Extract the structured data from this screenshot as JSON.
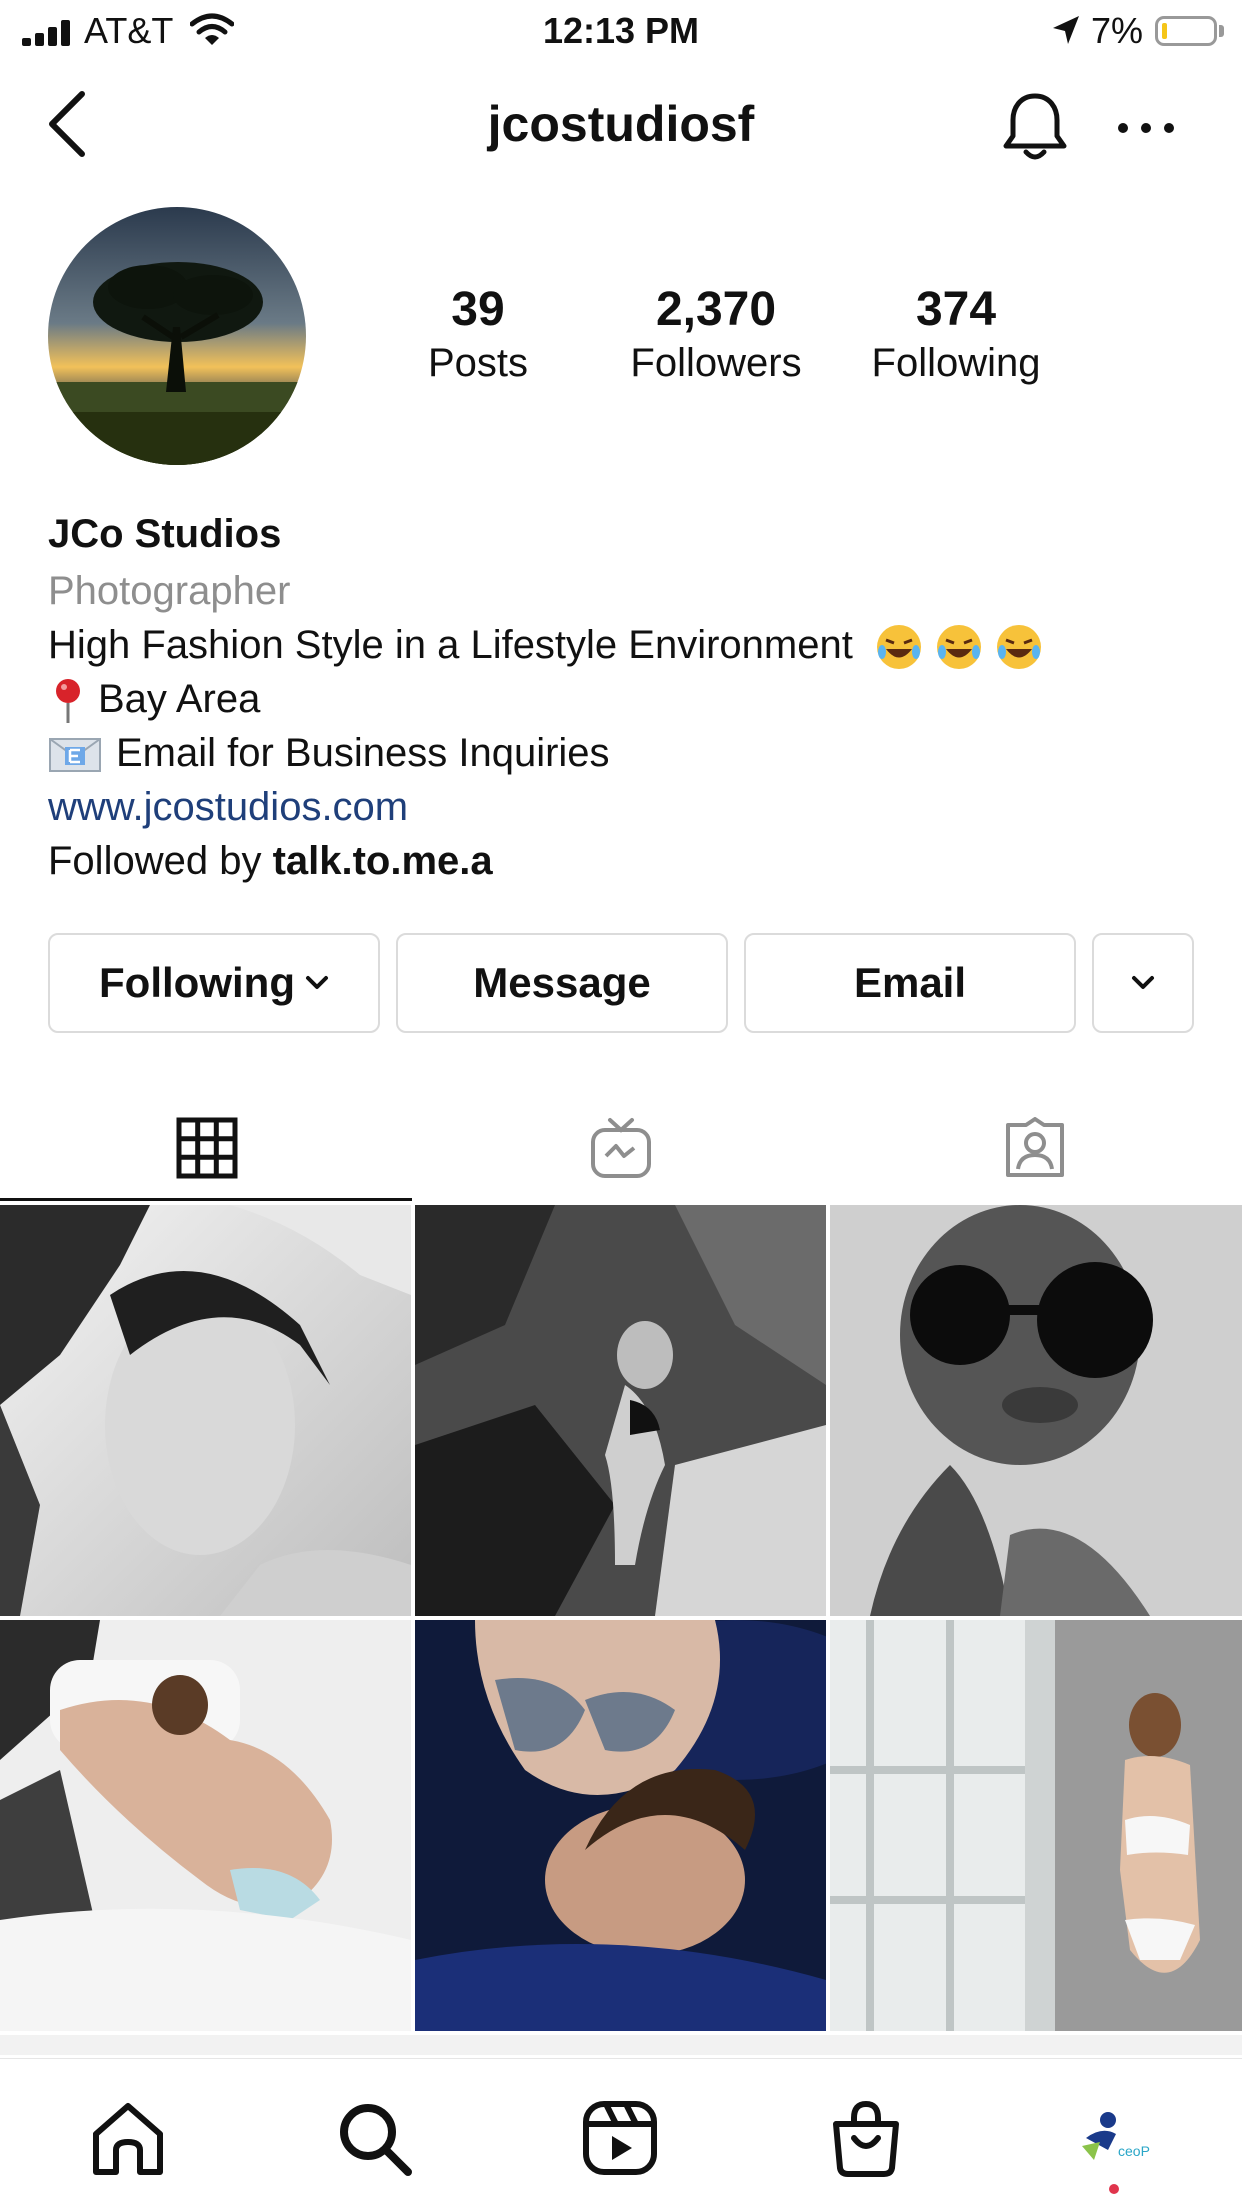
{
  "status_bar": {
    "carrier": "AT&T",
    "time": "12:13 PM",
    "battery_percent": "7%",
    "battery_level": 0.07
  },
  "header": {
    "title": "jcostudiosf",
    "icons": [
      "back-chevron-icon",
      "bell-icon",
      "more-horizontal-icon"
    ]
  },
  "profile": {
    "stats": [
      {
        "value": "39",
        "label": "Posts"
      },
      {
        "value": "2,370",
        "label": "Followers"
      },
      {
        "value": "374",
        "label": "Following"
      }
    ],
    "name": "JCo Studios",
    "category": "Photographer",
    "bio_lines": [
      "High Fashion Style in a Lifestyle Environment",
      "Bay Area",
      "Email for Business Inquiries"
    ],
    "bio_icons": [
      "laughing-emoji",
      "pin-emoji",
      "envelope-emoji"
    ],
    "website": "www.jcostudios.com",
    "followed_by_prefix": "Followed by ",
    "followed_by_user": "talk.to.me.a"
  },
  "actions": {
    "following_label": "Following",
    "message_label": "Message",
    "email_label": "Email"
  },
  "tabs": {
    "active": "grid",
    "icons": [
      "grid-icon",
      "igtv-icon",
      "tagged-icon"
    ]
  },
  "bottom_nav": {
    "icons": [
      "home-icon",
      "search-icon",
      "reels-icon",
      "shop-icon",
      "profile-avatar"
    ],
    "profile_badge_text": "ceoP"
  },
  "colors": {
    "link": "#1f3f7a",
    "secondary_text": "#8e8e8e",
    "border": "#dbdbdb",
    "notification_dot": "#e0344c"
  }
}
